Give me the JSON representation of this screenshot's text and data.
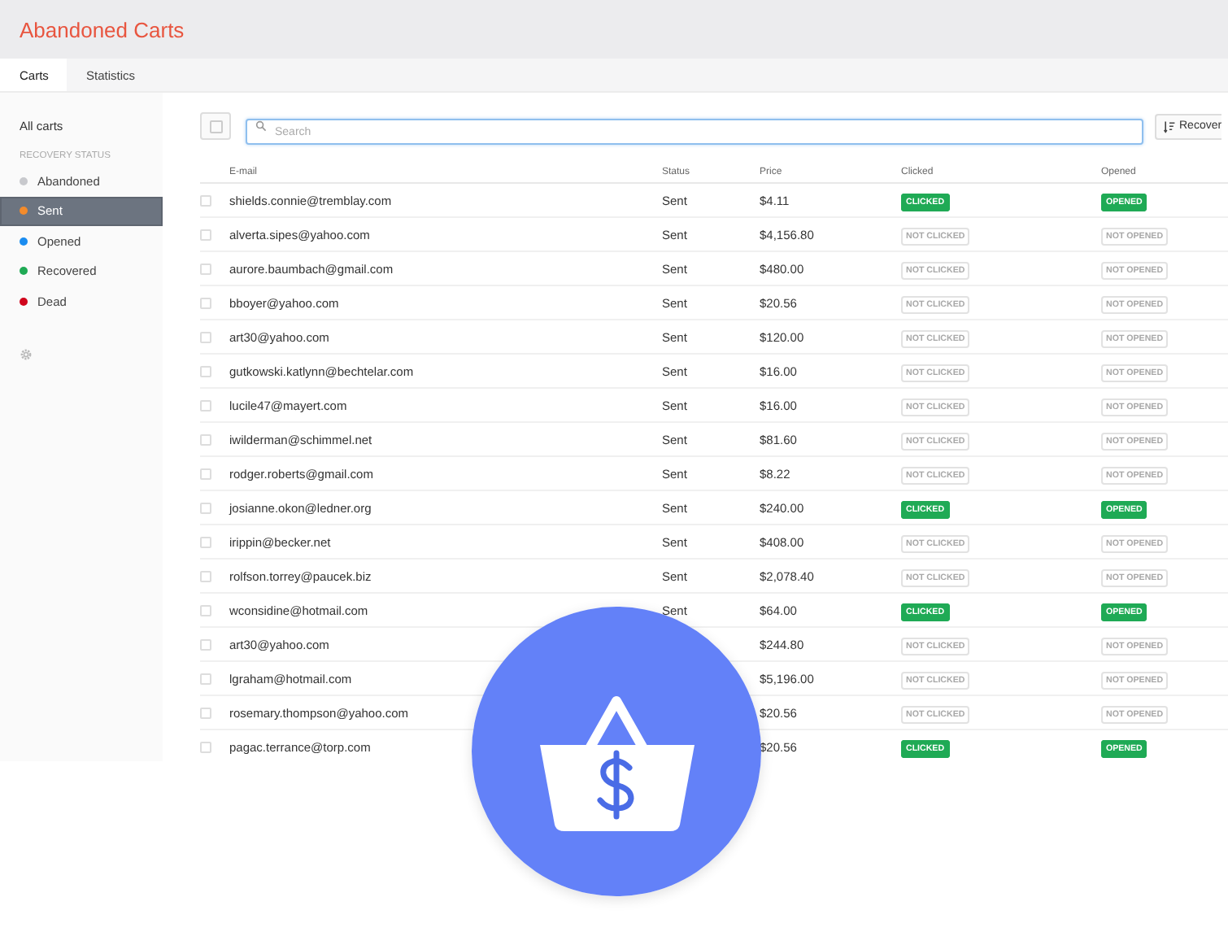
{
  "header": {
    "title": "Abandoned Carts"
  },
  "tabs": [
    {
      "label": "Carts",
      "selected": true
    },
    {
      "label": "Statistics",
      "selected": false
    }
  ],
  "sidebar": {
    "all_label": "All carts",
    "section_title": "RECOVERY STATUS",
    "items": [
      {
        "label": "Abandoned",
        "color": "#c8c9cd",
        "selected": false
      },
      {
        "label": "Sent",
        "color": "#f38b2b",
        "selected": true
      },
      {
        "label": "Opened",
        "color": "#1a8cf0",
        "selected": false
      },
      {
        "label": "Recovered",
        "color": "#1faa55",
        "selected": false
      },
      {
        "label": "Dead",
        "color": "#d0051c",
        "selected": false
      }
    ]
  },
  "select_all": {
    "checked": false
  },
  "search": {
    "placeholder": "Search"
  },
  "sort_button": {
    "label": "Recover"
  },
  "table": {
    "columns": [
      "E-mail",
      "Status",
      "Price",
      "Clicked",
      "Opened"
    ],
    "rows": [
      {
        "checked": false,
        "email": "shields.connie@tremblay.com",
        "status": "Sent",
        "price": "$4.11",
        "clicked": {
          "label": "CLICKED",
          "on": true
        },
        "opened": {
          "label": "OPENED",
          "on": true
        }
      },
      {
        "checked": false,
        "email": "alverta.sipes@yahoo.com",
        "status": "Sent",
        "price": "$4,156.80",
        "clicked": {
          "label": "NOT CLICKED",
          "on": false
        },
        "opened": {
          "label": "NOT OPENED",
          "on": false
        }
      },
      {
        "checked": false,
        "email": "aurore.baumbach@gmail.com",
        "status": "Sent",
        "price": "$480.00",
        "clicked": {
          "label": "NOT CLICKED",
          "on": false
        },
        "opened": {
          "label": "NOT OPENED",
          "on": false
        }
      },
      {
        "checked": false,
        "email": "bboyer@yahoo.com",
        "status": "Sent",
        "price": "$20.56",
        "clicked": {
          "label": "NOT CLICKED",
          "on": false
        },
        "opened": {
          "label": "NOT OPENED",
          "on": false
        }
      },
      {
        "checked": false,
        "email": "art30@yahoo.com",
        "status": "Sent",
        "price": "$120.00",
        "clicked": {
          "label": "NOT CLICKED",
          "on": false
        },
        "opened": {
          "label": "NOT OPENED",
          "on": false
        }
      },
      {
        "checked": false,
        "email": "gutkowski.katlynn@bechtelar.com",
        "status": "Sent",
        "price": "$16.00",
        "clicked": {
          "label": "NOT CLICKED",
          "on": false
        },
        "opened": {
          "label": "NOT OPENED",
          "on": false
        }
      },
      {
        "checked": false,
        "email": "lucile47@mayert.com",
        "status": "Sent",
        "price": "$16.00",
        "clicked": {
          "label": "NOT CLICKED",
          "on": false
        },
        "opened": {
          "label": "NOT OPENED",
          "on": false
        }
      },
      {
        "checked": false,
        "email": "iwilderman@schimmel.net",
        "status": "Sent",
        "price": "$81.60",
        "clicked": {
          "label": "NOT CLICKED",
          "on": false
        },
        "opened": {
          "label": "NOT OPENED",
          "on": false
        }
      },
      {
        "checked": false,
        "email": "rodger.roberts@gmail.com",
        "status": "Sent",
        "price": "$8.22",
        "clicked": {
          "label": "NOT CLICKED",
          "on": false
        },
        "opened": {
          "label": "NOT OPENED",
          "on": false
        }
      },
      {
        "checked": false,
        "email": "josianne.okon@ledner.org",
        "status": "Sent",
        "price": "$240.00",
        "clicked": {
          "label": "CLICKED",
          "on": true
        },
        "opened": {
          "label": "OPENED",
          "on": true
        }
      },
      {
        "checked": false,
        "email": "irippin@becker.net",
        "status": "Sent",
        "price": "$408.00",
        "clicked": {
          "label": "NOT CLICKED",
          "on": false
        },
        "opened": {
          "label": "NOT OPENED",
          "on": false
        }
      },
      {
        "checked": false,
        "email": "rolfson.torrey@paucek.biz",
        "status": "Sent",
        "price": "$2,078.40",
        "clicked": {
          "label": "NOT CLICKED",
          "on": false
        },
        "opened": {
          "label": "NOT OPENED",
          "on": false
        }
      },
      {
        "checked": false,
        "email": "wconsidine@hotmail.com",
        "status": "Sent",
        "price": "$64.00",
        "clicked": {
          "label": "CLICKED",
          "on": true
        },
        "opened": {
          "label": "OPENED",
          "on": true
        }
      },
      {
        "checked": false,
        "email": "art30@yahoo.com",
        "price": "$244.80",
        "clicked": {
          "label": "NOT CLICKED",
          "on": false
        },
        "opened": {
          "label": "NOT OPENED",
          "on": false
        }
      },
      {
        "checked": false,
        "email": "lgraham@hotmail.com",
        "price": "$5,196.00",
        "clicked": {
          "label": "NOT CLICKED",
          "on": false
        },
        "opened": {
          "label": "NOT OPENED",
          "on": false
        }
      },
      {
        "checked": false,
        "email": "rosemary.thompson@yahoo.com",
        "price": "$20.56",
        "clicked": {
          "label": "NOT CLICKED",
          "on": false
        },
        "opened": {
          "label": "NOT OPENED",
          "on": false
        }
      },
      {
        "checked": false,
        "email": "pagac.terrance@torp.com",
        "price": "$20.56",
        "clicked": {
          "label": "CLICKED",
          "on": true
        },
        "opened": {
          "label": "OPENED",
          "on": true
        }
      }
    ]
  }
}
